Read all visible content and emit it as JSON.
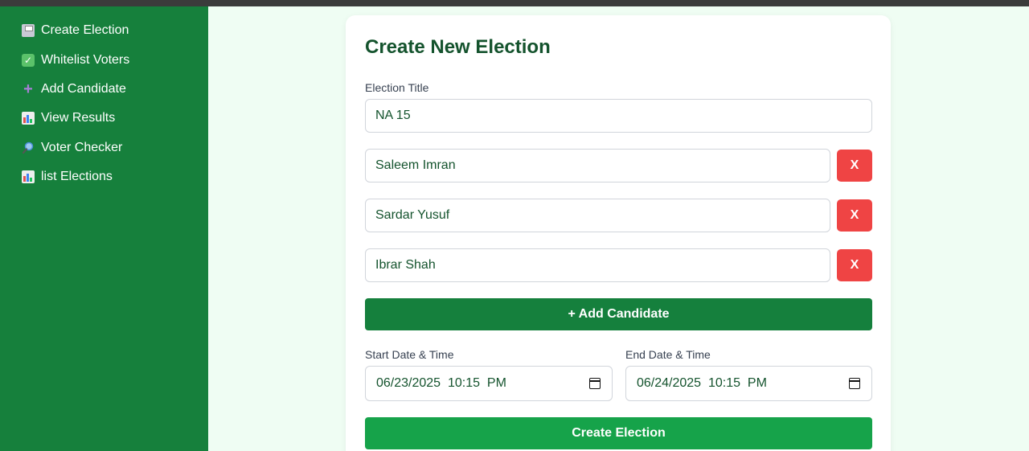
{
  "sidebar": {
    "items": [
      {
        "label": "Create Election",
        "icon": "ballot-box-icon"
      },
      {
        "label": "Whitelist Voters",
        "icon": "check-mark-icon"
      },
      {
        "label": "Add Candidate",
        "icon": "plus-icon"
      },
      {
        "label": "View Results",
        "icon": "bar-chart-icon"
      },
      {
        "label": "Voter Checker",
        "icon": "magnifier-icon"
      },
      {
        "label": "list Elections",
        "icon": "bar-chart-icon"
      }
    ]
  },
  "form": {
    "title": "Create New Election",
    "election_title_label": "Election Title",
    "election_title_value": "NA 15",
    "candidates": [
      "Saleem Imran",
      "Sardar Yusuf",
      "Ibrar Shah"
    ],
    "remove_label": "X",
    "add_candidate_label": "+ Add Candidate",
    "start_label": "Start Date & Time",
    "start_value": "06/23/2025  10:15  PM",
    "end_label": "End Date & Time",
    "end_value": "06/24/2025  10:15  PM",
    "submit_label": "Create Election"
  },
  "colors": {
    "sidebar": "#16803c",
    "background": "#effdf3",
    "title": "#14532d",
    "remove": "#ef4444",
    "add_button": "#15803d",
    "submit_button": "#16a34a"
  }
}
